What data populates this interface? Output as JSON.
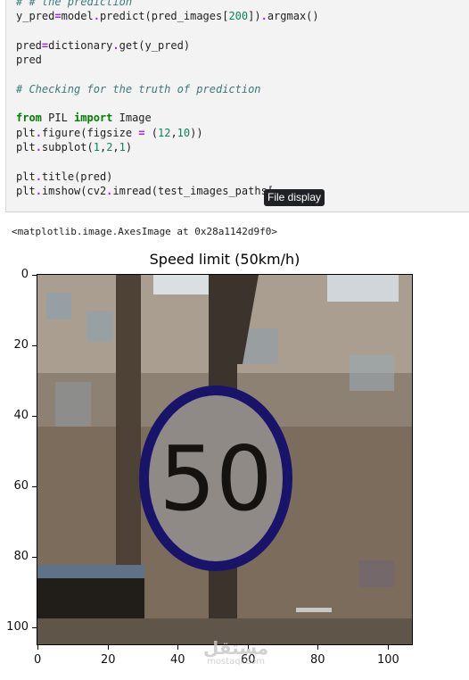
{
  "code_cell": {
    "lines": [
      [
        {
          "t": "# # the prediction",
          "c": "cm"
        }
      ],
      [
        {
          "t": "y_pred"
        },
        {
          "t": "=",
          "c": "op"
        },
        {
          "t": "model"
        },
        {
          "t": ".",
          "c": "op"
        },
        {
          "t": "predict(pred_images["
        },
        {
          "t": "200",
          "c": "num"
        },
        {
          "t": "])"
        },
        {
          "t": ".",
          "c": "op"
        },
        {
          "t": "argmax()"
        }
      ],
      [],
      [
        {
          "t": "pred"
        },
        {
          "t": "=",
          "c": "op"
        },
        {
          "t": "dictionary"
        },
        {
          "t": ".",
          "c": "op"
        },
        {
          "t": "get(y_pred)"
        }
      ],
      [
        {
          "t": "pred"
        }
      ],
      [],
      [
        {
          "t": "# Checking for the truth of prediction",
          "c": "cm"
        }
      ],
      [],
      [
        {
          "t": "from",
          "c": "kw"
        },
        {
          "t": " PIL "
        },
        {
          "t": "import",
          "c": "kw"
        },
        {
          "t": " Image"
        }
      ],
      [
        {
          "t": "plt"
        },
        {
          "t": ".",
          "c": "op"
        },
        {
          "t": "figure(figsize "
        },
        {
          "t": "=",
          "c": "op"
        },
        {
          "t": " ("
        },
        {
          "t": "12",
          "c": "num"
        },
        {
          "t": ","
        },
        {
          "t": "10",
          "c": "num"
        },
        {
          "t": "))"
        }
      ],
      [
        {
          "t": "plt"
        },
        {
          "t": ".",
          "c": "op"
        },
        {
          "t": "subplot("
        },
        {
          "t": "1",
          "c": "num"
        },
        {
          "t": ","
        },
        {
          "t": "2",
          "c": "num"
        },
        {
          "t": ","
        },
        {
          "t": "1",
          "c": "num"
        },
        {
          "t": ")"
        }
      ],
      [],
      [
        {
          "t": "plt"
        },
        {
          "t": ".",
          "c": "op"
        },
        {
          "t": "title(pred)"
        }
      ],
      [
        {
          "t": "plt"
        },
        {
          "t": ".",
          "c": "op"
        },
        {
          "t": "imshow(cv2"
        },
        {
          "t": ".",
          "c": "op"
        },
        {
          "t": "imread(test_images_paths["
        }
      ]
    ]
  },
  "tooltip": {
    "label": "File display"
  },
  "output": {
    "text": "<matplotlib.image.AxesImage at 0x28a1142d9f0>"
  },
  "figure": {
    "title": "Speed limit (50km/h)",
    "image_description": "Traffic sign photo: round speed-limit sign with number 50, displayed with BGR channels (ring appears dark blue)",
    "sign_number": "50",
    "colors": {
      "ring": "#17146a",
      "sign_face": "#8f8a86",
      "digits": "#151210"
    },
    "x_axis": {
      "ticks": [
        "0",
        "20",
        "40",
        "60",
        "80",
        "100"
      ],
      "range": [
        0,
        106
      ]
    },
    "y_axis": {
      "ticks": [
        "0",
        "20",
        "40",
        "60",
        "80",
        "100"
      ],
      "range": [
        0,
        106
      ]
    }
  },
  "watermark": {
    "arabic": "مستقل",
    "latin": "mostaql.com"
  }
}
